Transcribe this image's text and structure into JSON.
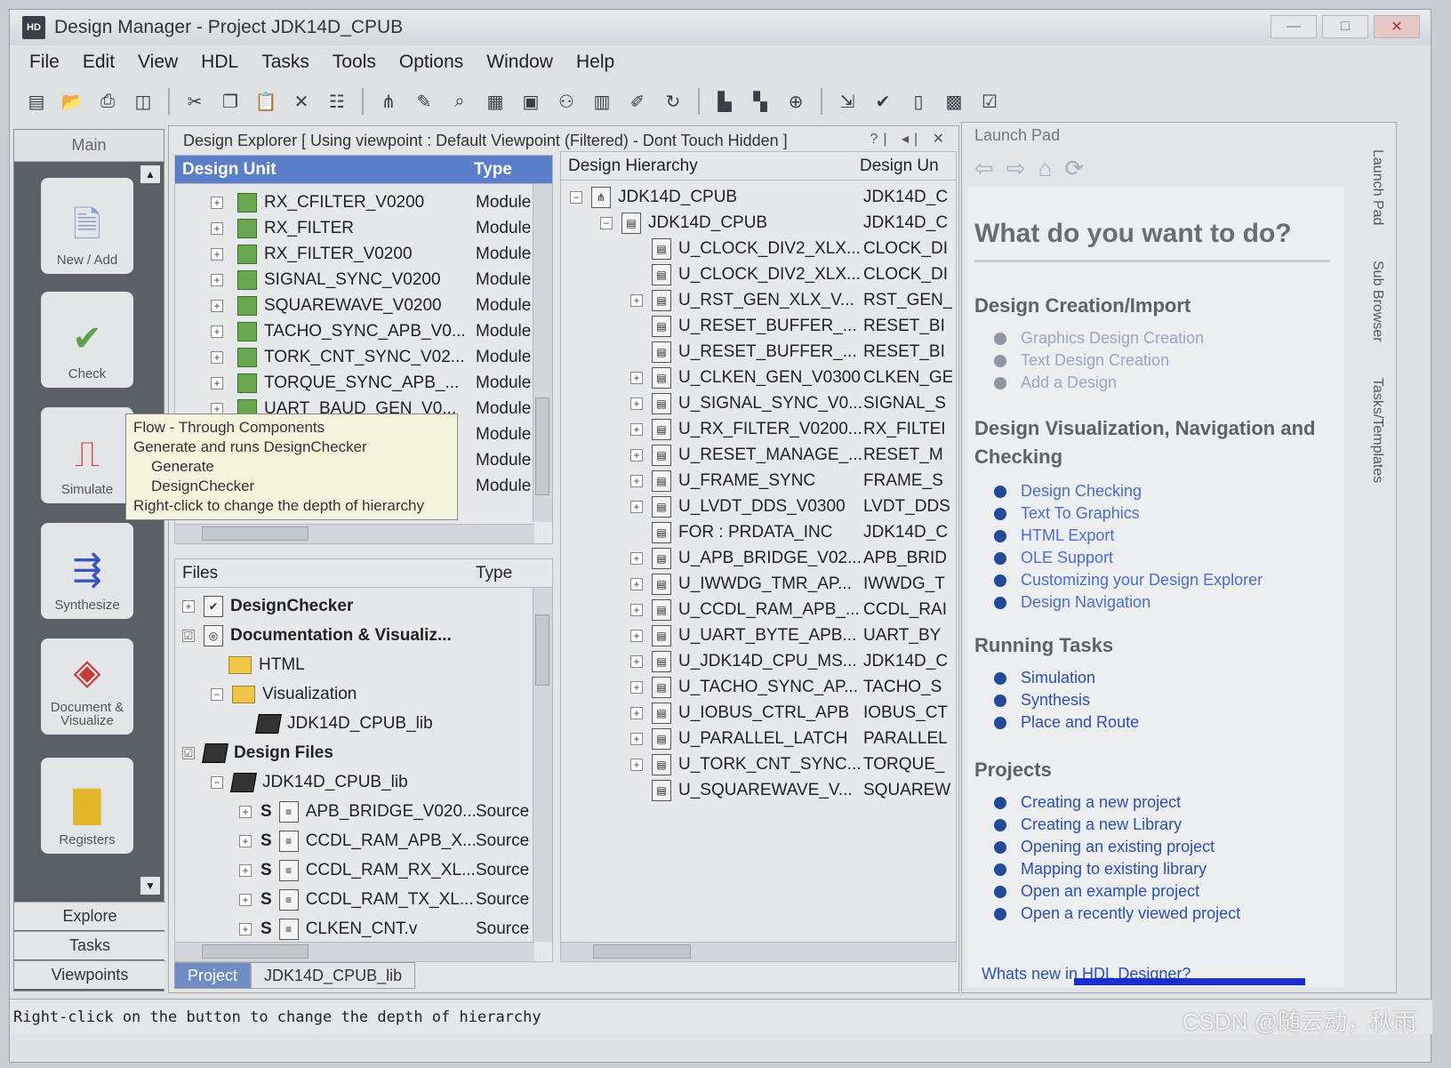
{
  "window": {
    "app_icon_text": "HD",
    "title": "Design Manager - Project JDK14D_CPUB",
    "minimize": "—",
    "maximize": "□",
    "close": "✕"
  },
  "menu": [
    "File",
    "Edit",
    "View",
    "HDL",
    "Tasks",
    "Tools",
    "Options",
    "Window",
    "Help"
  ],
  "toolbar_icons": [
    "new-file-icon",
    "open-icon",
    "print-icon",
    "print-preview-icon",
    "cut-icon",
    "copy-icon",
    "paste-icon",
    "delete-icon",
    "properties-icon",
    "hierarchy-icon",
    "edit-icon",
    "search-files-icon",
    "table-icon",
    "blocks-icon",
    "binoculars-icon",
    "chip-icon",
    "edit-document-icon",
    "refresh-icon",
    "library-icon",
    "library-map-icon",
    "find-icon",
    "export-icon",
    "check-icon",
    "columns-icon",
    "grid-icon",
    "checklist-icon"
  ],
  "leftnav": {
    "header": "Main",
    "tiles": [
      {
        "label": "New / Add",
        "icon": "new-add-icon"
      },
      {
        "label": "Check",
        "icon": "check-icon"
      },
      {
        "label": "Simulate",
        "icon": "simulate-icon"
      },
      {
        "label": "Synthesize",
        "icon": "synthesize-icon"
      },
      {
        "label": "Document & Visualize",
        "icon": "document-visualize-icon"
      },
      {
        "label": "Registers",
        "icon": "registers-icon"
      }
    ],
    "bottom": [
      "Explore",
      "Tasks",
      "Viewpoints"
    ]
  },
  "explorer": {
    "title": "Design Explorer [ Using viewpoint :  Default Viewpoint (Filtered) - Dont Touch Hidden ]",
    "controls": "?| ◂| ✕",
    "units": {
      "col_unit": "Design Unit",
      "col_type": "Type",
      "rows": [
        {
          "name": "RX_CFILTER_V0200",
          "type": "Module"
        },
        {
          "name": "RX_FILTER",
          "type": "Module"
        },
        {
          "name": "RX_FILTER_V0200",
          "type": "Module"
        },
        {
          "name": "SIGNAL_SYNC_V0200",
          "type": "Module"
        },
        {
          "name": "SQUAREWAVE_V0200",
          "type": "Module"
        },
        {
          "name": "TACHO_SYNC_APB_V0...",
          "type": "Module"
        },
        {
          "name": "TORK_CNT_SYNC_V02...",
          "type": "Module"
        },
        {
          "name": "TORQUE_SYNC_APB_...",
          "type": "Module"
        },
        {
          "name": "UART_BAUD_GEN_V0...",
          "type": "Module"
        },
        {
          "name": "...",
          "type": "Module"
        },
        {
          "name": "...",
          "type": "Module"
        },
        {
          "name": "...",
          "type": "Module"
        }
      ]
    },
    "tooltip": [
      "Flow - Through Components",
      "Generate and runs DesignChecker",
      "    Generate",
      "    DesignChecker",
      "Right-click to change the depth of hierarchy"
    ],
    "files": {
      "col_files": "Files",
      "col_type": "Type",
      "rows": [
        {
          "name": "DesignChecker",
          "type": ""
        },
        {
          "name": "Documentation & Visualiz...",
          "type": ""
        },
        {
          "name": "HTML",
          "type": ""
        },
        {
          "name": "Visualization",
          "type": ""
        },
        {
          "name": "JDK14D_CPUB_lib",
          "type": ""
        },
        {
          "name": "Design Files",
          "type": ""
        },
        {
          "name": "JDK14D_CPUB_lib",
          "type": ""
        },
        {
          "name": "APB_BRIDGE_V020...",
          "type": "Source"
        },
        {
          "name": "CCDL_RAM_APB_X...",
          "type": "Source"
        },
        {
          "name": "CCDL_RAM_RX_XL...",
          "type": "Source"
        },
        {
          "name": "CCDL_RAM_TX_XL...",
          "type": "Source"
        },
        {
          "name": "CLKEN_CNT.v",
          "type": "Source"
        }
      ],
      "source_marker": "S"
    },
    "hierarchy": {
      "col_hier": "Design Hierarchy",
      "col_unit": "Design Un",
      "rows": [
        {
          "name": "JDK14D_CPUB",
          "unit": "JDK14D_C"
        },
        {
          "name": "JDK14D_CPUB",
          "unit": "JDK14D_C"
        },
        {
          "name": "U_CLOCK_DIV2_XLX...",
          "unit": "CLOCK_DI"
        },
        {
          "name": "U_CLOCK_DIV2_XLX...",
          "unit": "CLOCK_DI"
        },
        {
          "name": "U_RST_GEN_XLX_V...",
          "unit": "RST_GEN_"
        },
        {
          "name": "U_RESET_BUFFER_...",
          "unit": "RESET_BI"
        },
        {
          "name": "U_RESET_BUFFER_...",
          "unit": "RESET_BI"
        },
        {
          "name": "U_CLKEN_GEN_V0300",
          "unit": "CLKEN_GE"
        },
        {
          "name": "U_SIGNAL_SYNC_V0...",
          "unit": "SIGNAL_S"
        },
        {
          "name": "U_RX_FILTER_V0200...",
          "unit": "RX_FILTEI"
        },
        {
          "name": "U_RESET_MANAGE_...",
          "unit": "RESET_M"
        },
        {
          "name": "U_FRAME_SYNC",
          "unit": "FRAME_S"
        },
        {
          "name": "U_LVDT_DDS_V0300",
          "unit": "LVDT_DDS"
        },
        {
          "name": "FOR : PRDATA_INC",
          "unit": "JDK14D_C"
        },
        {
          "name": "U_APB_BRIDGE_V02...",
          "unit": "APB_BRID"
        },
        {
          "name": "U_IWWDG_TMR_AP...",
          "unit": "IWWDG_T"
        },
        {
          "name": "U_CCDL_RAM_APB_...",
          "unit": "CCDL_RAI"
        },
        {
          "name": "U_UART_BYTE_APB...",
          "unit": "UART_BY"
        },
        {
          "name": "U_JDK14D_CPU_MS...",
          "unit": "JDK14D_C"
        },
        {
          "name": "U_TACHO_SYNC_AP...",
          "unit": "TACHO_S"
        },
        {
          "name": "U_IOBUS_CTRL_APB",
          "unit": "IOBUS_CT"
        },
        {
          "name": "U_PARALLEL_LATCH",
          "unit": "PARALLEL"
        },
        {
          "name": "U_TORK_CNT_SYNC...",
          "unit": "TORQUE_"
        },
        {
          "name": "U_SQUAREWAVE_V...",
          "unit": "SQUAREW"
        }
      ]
    },
    "tabs": [
      "Project",
      "JDK14D_CPUB_lib"
    ]
  },
  "launchpad": {
    "title": "Launch Pad",
    "heading": "What do you want to do?",
    "sections": [
      {
        "title": "Design Creation/Import",
        "links": [
          "Graphics Design Creation",
          "Text Design Creation",
          "Add a Design"
        ]
      },
      {
        "title": "Design Visualization, Navigation and Checking",
        "links": [
          "Design Checking",
          "Text To Graphics",
          "HTML Export",
          "OLE Support",
          "Customizing your Design Explorer",
          "Design Navigation"
        ]
      },
      {
        "title": "Running Tasks",
        "links": [
          "Simulation",
          "Synthesis",
          "Place and Route"
        ]
      },
      {
        "title": "Projects",
        "links": [
          "Creating a new project",
          "Creating a new Library",
          "Opening an existing project",
          "Mapping to existing library",
          "Open an example project",
          "Open a recently viewed project"
        ]
      }
    ],
    "whats_new": "Whats new in HDL Designer?",
    "side_tabs": [
      "Launch Pad",
      "Sub Browser",
      "Tasks/Templates"
    ]
  },
  "statusbar": "Right-click on the button to change the depth of hierarchy",
  "watermark": "CSDN @随云动，秋雨"
}
